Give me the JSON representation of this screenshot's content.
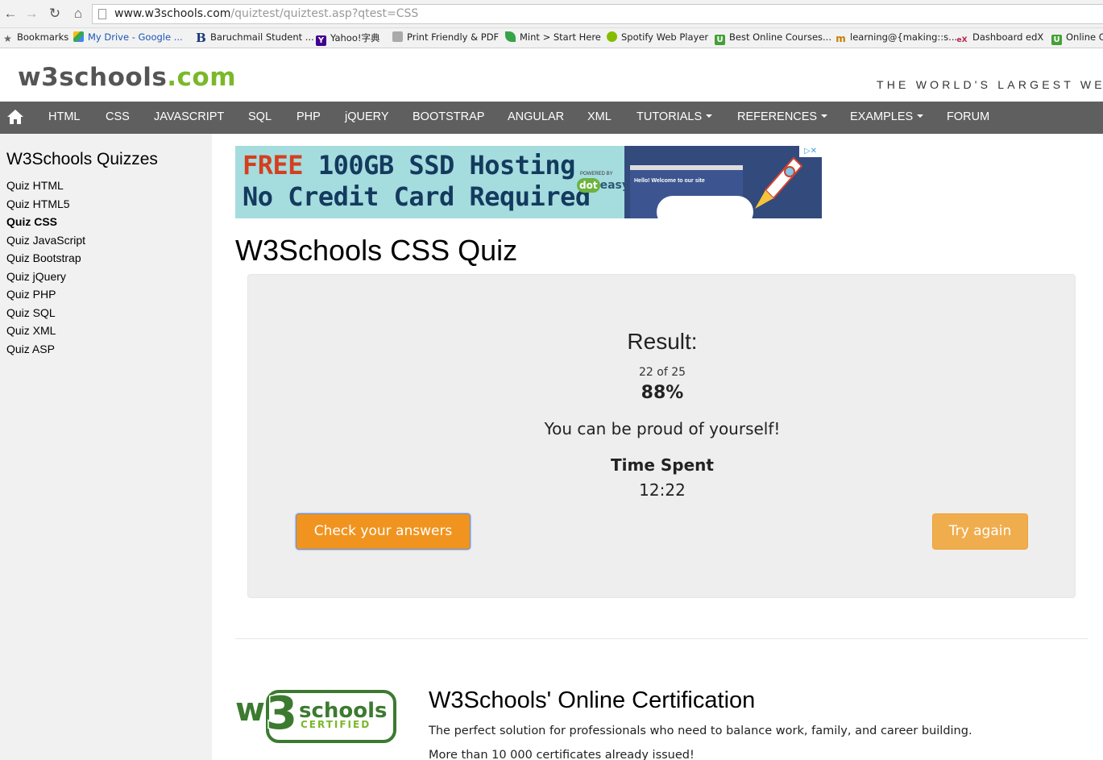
{
  "browser": {
    "url_host": "www.w3schools.com",
    "url_path": "/quiztest/quiztest.asp?qtest=CSS",
    "bookmarks": [
      {
        "label": "Bookmarks",
        "icon": "star-icon"
      },
      {
        "label": "My Drive - Google ...",
        "icon": "google-drive-icon"
      },
      {
        "label": "Baruchmail Student ...",
        "icon": "baruch-icon"
      },
      {
        "label": "Yahoo!字典",
        "icon": "yahoo-icon"
      },
      {
        "label": "Print Friendly & PDF",
        "icon": "printer-icon"
      },
      {
        "label": "Mint > Start Here",
        "icon": "mint-leaf-icon"
      },
      {
        "label": "Spotify Web Player",
        "icon": "spotify-icon"
      },
      {
        "label": "Best Online Courses...",
        "icon": "udemy-icon"
      },
      {
        "label": "learning@{making::s...",
        "icon": "mortarboard-icon"
      },
      {
        "label": "Dashboard  edX",
        "icon": "edx-icon"
      },
      {
        "label": "Online C",
        "icon": "udemy-icon"
      }
    ]
  },
  "site": {
    "logo_main": "w3schools",
    "logo_tld": ".com",
    "tagline": "THE WORLD'S LARGEST WEB"
  },
  "topnav": [
    {
      "label": "HTML",
      "dropdown": false
    },
    {
      "label": "CSS",
      "dropdown": false
    },
    {
      "label": "JAVASCRIPT",
      "dropdown": false
    },
    {
      "label": "SQL",
      "dropdown": false
    },
    {
      "label": "PHP",
      "dropdown": false
    },
    {
      "label": "jQUERY",
      "dropdown": false
    },
    {
      "label": "BOOTSTRAP",
      "dropdown": false
    },
    {
      "label": "ANGULAR",
      "dropdown": false
    },
    {
      "label": "XML",
      "dropdown": false
    },
    {
      "label": "TUTORIALS",
      "dropdown": true
    },
    {
      "label": "REFERENCES",
      "dropdown": true
    },
    {
      "label": "EXAMPLES",
      "dropdown": true
    },
    {
      "label": "FORUM",
      "dropdown": false
    }
  ],
  "sidebar": {
    "title": "W3Schools Quizzes",
    "items": [
      {
        "label": "Quiz HTML",
        "active": false
      },
      {
        "label": "Quiz HTML5",
        "active": false
      },
      {
        "label": "Quiz CSS",
        "active": true
      },
      {
        "label": "Quiz JavaScript",
        "active": false
      },
      {
        "label": "Quiz Bootstrap",
        "active": false
      },
      {
        "label": "Quiz jQuery",
        "active": false
      },
      {
        "label": "Quiz PHP",
        "active": false
      },
      {
        "label": "Quiz SQL",
        "active": false
      },
      {
        "label": "Quiz XML",
        "active": false
      },
      {
        "label": "Quiz ASP",
        "active": false
      }
    ]
  },
  "ad": {
    "free": "FREE",
    "line1_rest": " 100GB SSD Hosting",
    "line2": "No Credit Card Required",
    "powered_by": "POWERED BY",
    "brand_dot": "dot",
    "brand_rest": "easy",
    "panel_text": "Hello! Welcome to our site"
  },
  "main": {
    "title": "W3Schools CSS Quiz",
    "result": {
      "heading": "Result:",
      "score": "22 of 25",
      "percent": "88%",
      "message": "You can be proud of yourself!",
      "time_label": "Time Spent",
      "time_value": "12:22"
    },
    "buttons": {
      "check": "Check your answers",
      "try": "Try again"
    }
  },
  "certification": {
    "logo_text": "schools",
    "logo_sub": "CERTIFIED",
    "title": "W3Schools' Online Certification",
    "description": "The perfect solution for professionals who need to balance work, family, and career building.",
    "count": "More than 10 000 certificates already issued!"
  },
  "colors": {
    "nav_bg": "#5f5f5f",
    "brand_green": "#7ab829",
    "btn_orange": "#f0941f",
    "btn_try": "#f0ad4e",
    "cert_green": "#3c7a30"
  }
}
